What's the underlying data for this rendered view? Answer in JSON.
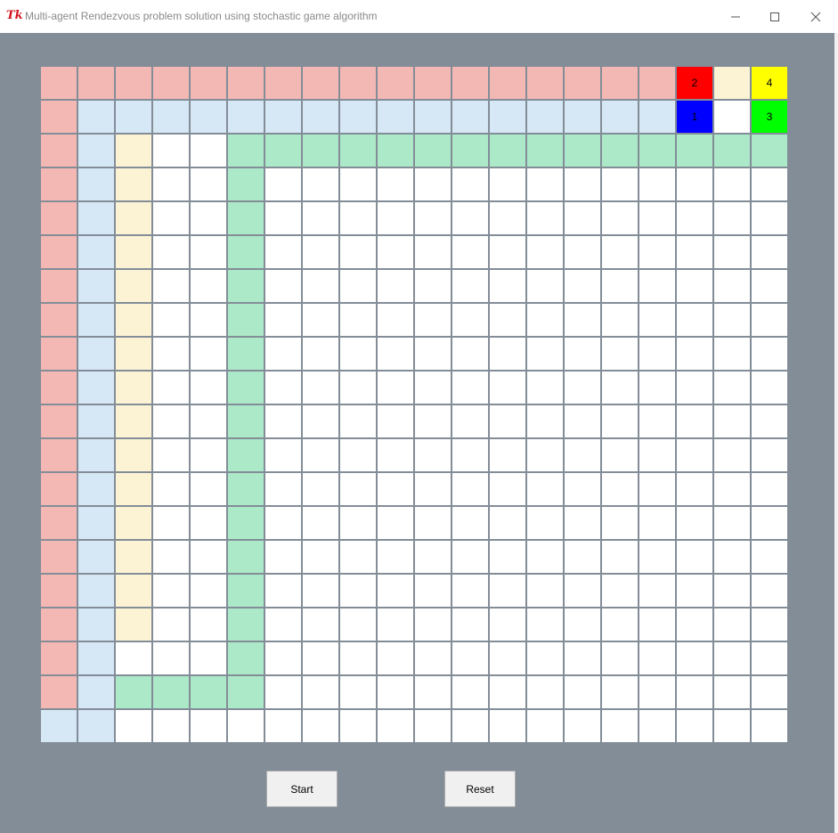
{
  "window": {
    "title": "Multi-agent Rendezvous problem solution using stochastic game algorithm",
    "controls": [
      "minimize",
      "maximize",
      "close"
    ]
  },
  "grid": {
    "rows": 20,
    "cols": 20,
    "colors": {
      "W": "#ffffff",
      "P": "#f4b8b4",
      "B": "#d6e7f5",
      "Y": "#fcf3d5",
      "G": "#ace9c8",
      "R": "#ff0000",
      "N": "#0000ff",
      "L": "#ffff00",
      "E": "#00ff00"
    },
    "layout": [
      "PPPPPPPPPPPPPPPPPRYL",
      "PBBBBBBBBBBBBBBBBNWE",
      "PBYWWGGGGGGGGGGGGGGG",
      "PBYWWGWWWWWWWWWWWWWW",
      "PBYWWGWWWWWWWWWWWWWW",
      "PBYWWGWWWWWWWWWWWWWW",
      "PBYWWGWWWWWWWWWWWWWW",
      "PBYWWGWWWWWWWWWWWWWW",
      "PBYWWGWWWWWWWWWWWWWW",
      "PBYWWGWWWWWWWWWWWWWW",
      "PBYWWGWWWWWWWWWWWWWW",
      "PBYWWGWWWWWWWWWWWWWW",
      "PBYWWGWWWWWWWWWWWWWW",
      "PBYWWGWWWWWWWWWWWWWW",
      "PBYWWGWWWWWWWWWWWWWW",
      "PBYWWGWWWWWWWWWWWWWW",
      "PBYWWGWWWWWWWWWWWWWW",
      "PBWWWGWWWWWWWWWWWWWW",
      "PBGGGGWWWWWWWWWWWWWW",
      "BBWWWWWWWWWWWWWWWWWW"
    ],
    "agents": [
      {
        "label": "2",
        "row": 0,
        "col": 17
      },
      {
        "label": "4",
        "row": 0,
        "col": 19
      },
      {
        "label": "1",
        "row": 1,
        "col": 17
      },
      {
        "label": "3",
        "row": 1,
        "col": 19
      }
    ]
  },
  "buttons": {
    "start_label": "Start",
    "reset_label": "Reset"
  }
}
